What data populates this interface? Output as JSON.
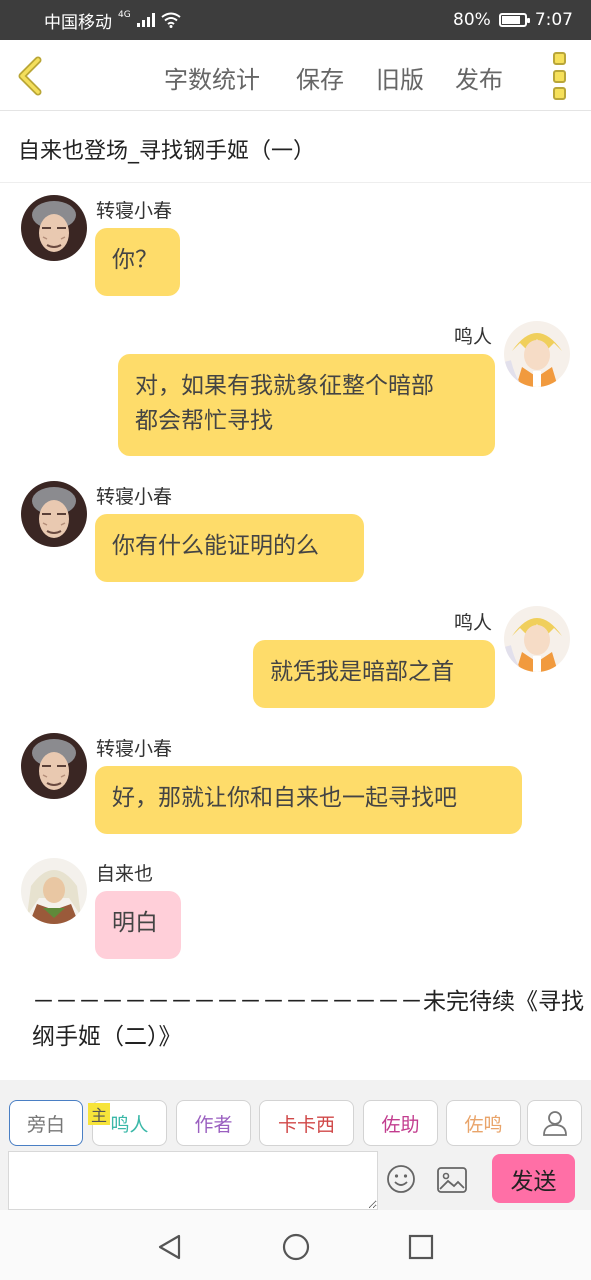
{
  "status_bar": {
    "carrier": "中国移动",
    "network": "4G",
    "battery_percent": "80%",
    "battery_level": 0.8,
    "time": "7:07"
  },
  "toolbar": {
    "actions": [
      "字数统计",
      "保存",
      "旧版",
      "发布"
    ]
  },
  "story_title": "自来也登场_寻找钢手姬（一）",
  "messages": [
    {
      "speaker": "转寝小春",
      "text": "你？",
      "side": "left",
      "style": "yellow"
    },
    {
      "speaker": "鸣人",
      "text": "对，如果有我就象征整个暗部都会帮忙寻找",
      "lines": [
        "对，如果有我就象征整个暗部",
        "都会帮忙寻找"
      ],
      "side": "right",
      "style": "yellow"
    },
    {
      "speaker": "转寝小春",
      "text": "你有什么能证明的么",
      "side": "left",
      "style": "yellow"
    },
    {
      "speaker": "鸣人",
      "text": "就凭我是暗部之首",
      "side": "right",
      "style": "yellow"
    },
    {
      "speaker": "转寝小春",
      "text": "好，那就让你和自来也一起寻找吧",
      "side": "left",
      "style": "yellow"
    },
    {
      "speaker": "自来也",
      "text": "明白",
      "side": "left",
      "style": "pink"
    }
  ],
  "narration": {
    "line1": "－－－－－－－－－－－－－－－－－未完待续《寻找",
    "line2": "纲手姬（二）》"
  },
  "roles": {
    "host_tag": "主",
    "items": [
      {
        "label": "旁白",
        "color": "#777777"
      },
      {
        "label": "鸣人",
        "color": "#3bb8a8"
      },
      {
        "label": "作者",
        "color": "#9a5fc0"
      },
      {
        "label": "卡卡西",
        "color": "#d04848"
      },
      {
        "label": "佐助",
        "color": "#c23c8e"
      },
      {
        "label": "佐鸣",
        "color": "#e9a46a"
      }
    ]
  },
  "composer": {
    "input_value": "",
    "send_label": "发送"
  },
  "icons": {
    "back": "chevron-left-icon",
    "more": "more-icon",
    "user": "user-icon",
    "emoji": "emoji-icon",
    "image": "image-icon"
  },
  "colors": {
    "bubble_yellow": "#fedc6a",
    "bubble_pink": "#ffcfd9",
    "send": "#ff6fa6"
  }
}
